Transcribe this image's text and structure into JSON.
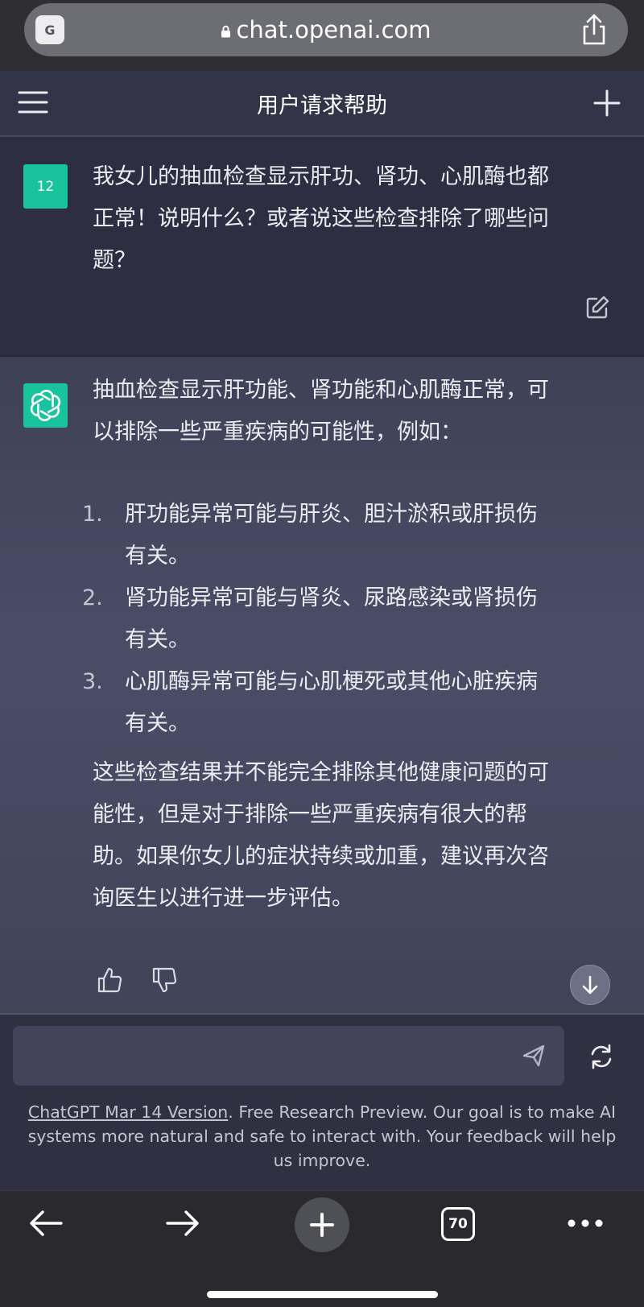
{
  "browser": {
    "translate_label": "G",
    "url": "chat.openai.com",
    "tab_count": "70"
  },
  "header": {
    "title": "用户请求帮助"
  },
  "user_message": {
    "avatar_text": "12",
    "lines": [
      "我女儿的抽血检查显示肝功、肾功、心肌酶也都",
      "正常！说明什么？或者说这些检查排除了哪些问",
      "题？"
    ]
  },
  "assistant_message": {
    "intro_lines": [
      "抽血检查显示肝功能、肾功能和心肌酶正常，可",
      "以排除一些严重疾病的可能性，例如："
    ],
    "list": [
      {
        "num": "1.",
        "lines": [
          "肝功能异常可能与肝炎、胆汁淤积或肝损伤",
          "有关。"
        ]
      },
      {
        "num": "2.",
        "lines": [
          "肾功能异常可能与肾炎、尿路感染或肾损伤",
          "有关。"
        ]
      },
      {
        "num": "3.",
        "lines": [
          "心肌酶异常可能与心肌梗死或其他心脏疾病",
          "有关。"
        ]
      }
    ],
    "conclusion_lines": [
      "这些检查结果并不能完全排除其他健康问题的可",
      "能性，但是对于排除一些严重疾病有很大的帮",
      "助。如果你女儿的症状持续或加重，建议再次咨",
      "询医生以进行进一步评估。"
    ]
  },
  "composer": {
    "input_value": "",
    "input_placeholder": ""
  },
  "footer": {
    "link_text": "ChatGPT Mar 14 Version",
    "text": ". Free Research Preview. Our goal is to make AI systems more natural and safe to interact with. Your feedback will help us improve."
  },
  "colors": {
    "accent": "#19c39c",
    "assistant_bg": "#454860",
    "user_bg": "#2e2e42"
  }
}
